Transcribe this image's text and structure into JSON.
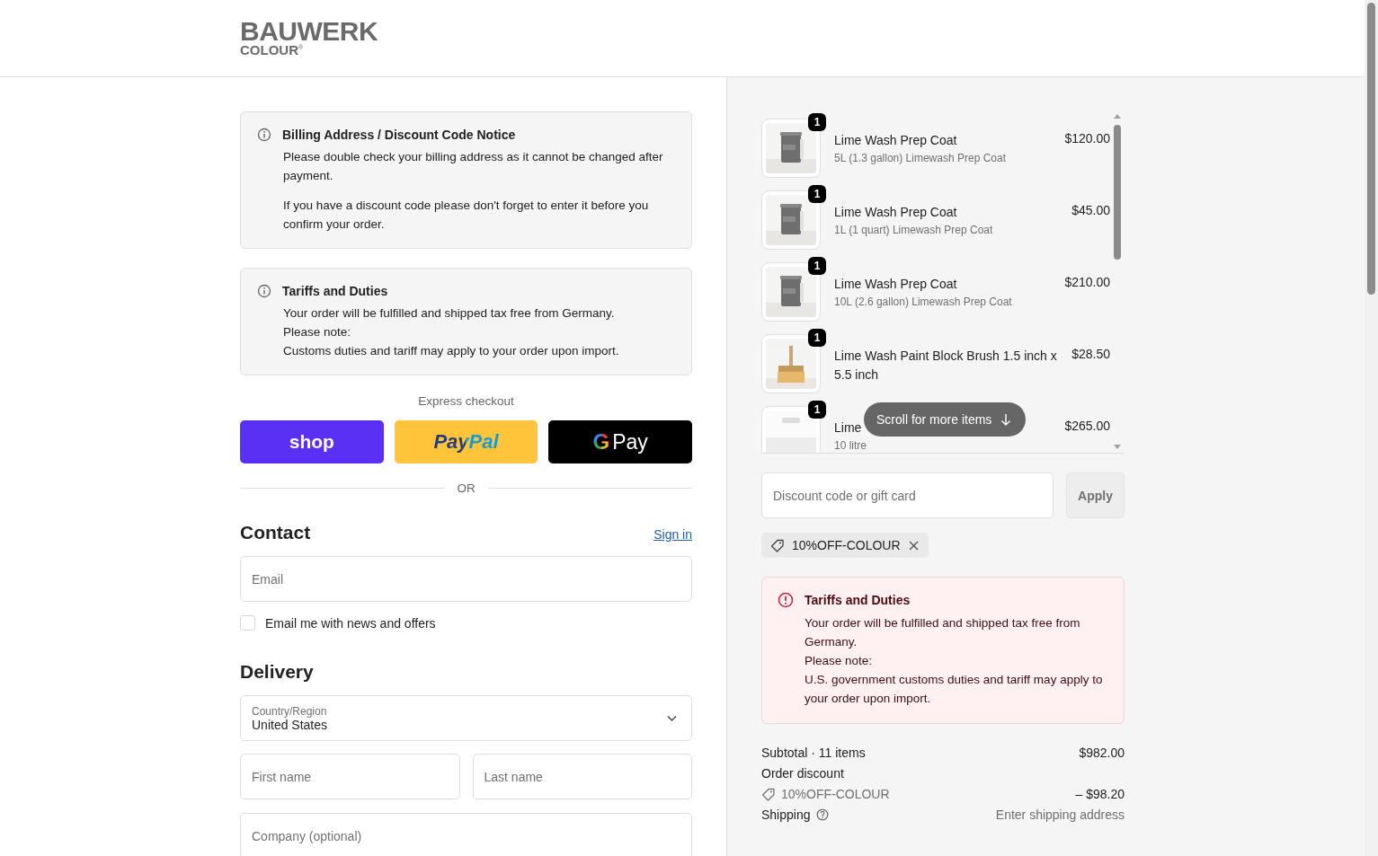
{
  "header": {
    "logo": {
      "name": "BAUWERK",
      "sub": "COLOUR",
      "mark": "®"
    }
  },
  "notices": [
    {
      "title": "Billing Address / Discount Code Notice",
      "paragraphs": [
        "Please double check your billing address as it cannot be changed after payment.",
        "If you have a discount code please don't forget to enter it before you confirm your order."
      ]
    },
    {
      "title": "Tariffs and Duties",
      "paragraphs": [
        "Your order will be fulfilled and shipped tax free from Germany.\nPlease note:\nCustoms duties and tariff may apply to your order upon import."
      ]
    }
  ],
  "express_checkout": {
    "label": "Express checkout",
    "buttons": [
      {
        "kind": "shop",
        "label": "shop"
      },
      {
        "kind": "paypal",
        "label": "PayPal"
      },
      {
        "kind": "gpay",
        "mark": "G",
        "label": "Pay"
      }
    ],
    "divider": "OR"
  },
  "contact": {
    "heading": "Contact",
    "sign_in": "Sign in",
    "email": {
      "placeholder": "Email"
    },
    "newsletter": {
      "label": "Email me with news and offers",
      "checked": false
    }
  },
  "delivery": {
    "heading": "Delivery",
    "country": {
      "label": "Country/Region",
      "value": "United States"
    },
    "first_name": {
      "placeholder": "First name"
    },
    "last_name": {
      "placeholder": "Last name"
    },
    "company": {
      "placeholder": "Company (optional)"
    }
  },
  "order": {
    "items": [
      {
        "quantity": "1",
        "title": "Lime Wash Prep Coat",
        "variant": "5L (1.3 gallon) Limewash Prep Coat",
        "price": "$120.00"
      },
      {
        "quantity": "1",
        "title": "Lime Wash Prep Coat",
        "variant": "1L (1 quart) Limewash Prep Coat",
        "price": "$45.00"
      },
      {
        "quantity": "1",
        "title": "Lime Wash Prep Coat",
        "variant": "10L (2.6 gallon) Limewash Prep Coat",
        "price": "$210.00"
      },
      {
        "quantity": "1",
        "title": "Lime Wash Paint Block Brush 1.5 inch x 5.5 inch",
        "price": "$28.50"
      },
      {
        "quantity": "1",
        "title": "Lime",
        "variant": "10 litre",
        "price": "$265.00"
      }
    ],
    "scroll_hint": "Scroll for more items",
    "discount_field": {
      "placeholder": "Discount code or gift card"
    },
    "apply_button": {
      "label": "Apply",
      "disabled": true
    },
    "applied_code": "10%OFF-COLOUR",
    "alert": {
      "title": "Tariffs and Duties",
      "paragraphs": [
        "Your order will be fulfilled and shipped tax free from Germany.\nPlease note:\nU.S. government customs duties and tariff may apply to your order upon import."
      ]
    },
    "summary": [
      {
        "kind": "line",
        "label": "Subtotal · 11 items",
        "value": "$982.00"
      },
      {
        "kind": "heading",
        "label": "Order discount"
      },
      {
        "kind": "discount",
        "label": "10%OFF-COLOUR",
        "value": "– $98.20"
      },
      {
        "kind": "help",
        "label": "Shipping",
        "value": "Enter shipping address"
      }
    ]
  }
}
